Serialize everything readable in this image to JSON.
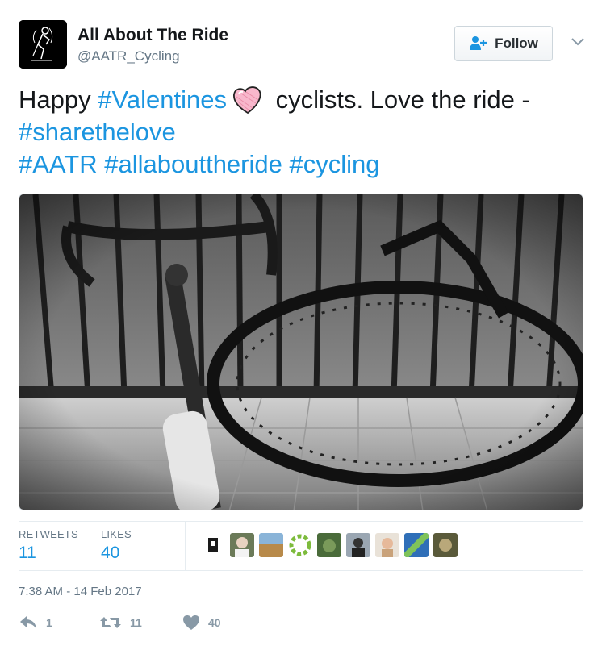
{
  "author": {
    "display_name": "All About The Ride",
    "handle": "@AATR_Cycling"
  },
  "follow_button": {
    "label": "Follow",
    "icon": "add-user-icon"
  },
  "tweet": {
    "line1": {
      "before": "Happy ",
      "hashtag": "#Valentines",
      "emoji": "heart-emoji",
      "after": " cyclists. Love the ride -"
    },
    "line2": {
      "hashtag": "#sharethelove"
    },
    "line3": {
      "hashtag1": "#AATR",
      "hashtag2": "#allabouttheride",
      "hashtag3": "#cycling"
    }
  },
  "photo": {
    "description": "black-and-white bicycle shadow photo"
  },
  "stats": {
    "retweets_label": "RETWEETS",
    "retweets_value": "11",
    "likes_label": "LIKES",
    "likes_value": "40"
  },
  "timestamp": "7:38 AM - 14 Feb 2017",
  "actions": {
    "reply_count": "1",
    "retweet_count": "11",
    "like_count": "40"
  },
  "colors": {
    "link": "#1b95e0",
    "secondary": "#657786",
    "action_icon": "#8899a6"
  }
}
